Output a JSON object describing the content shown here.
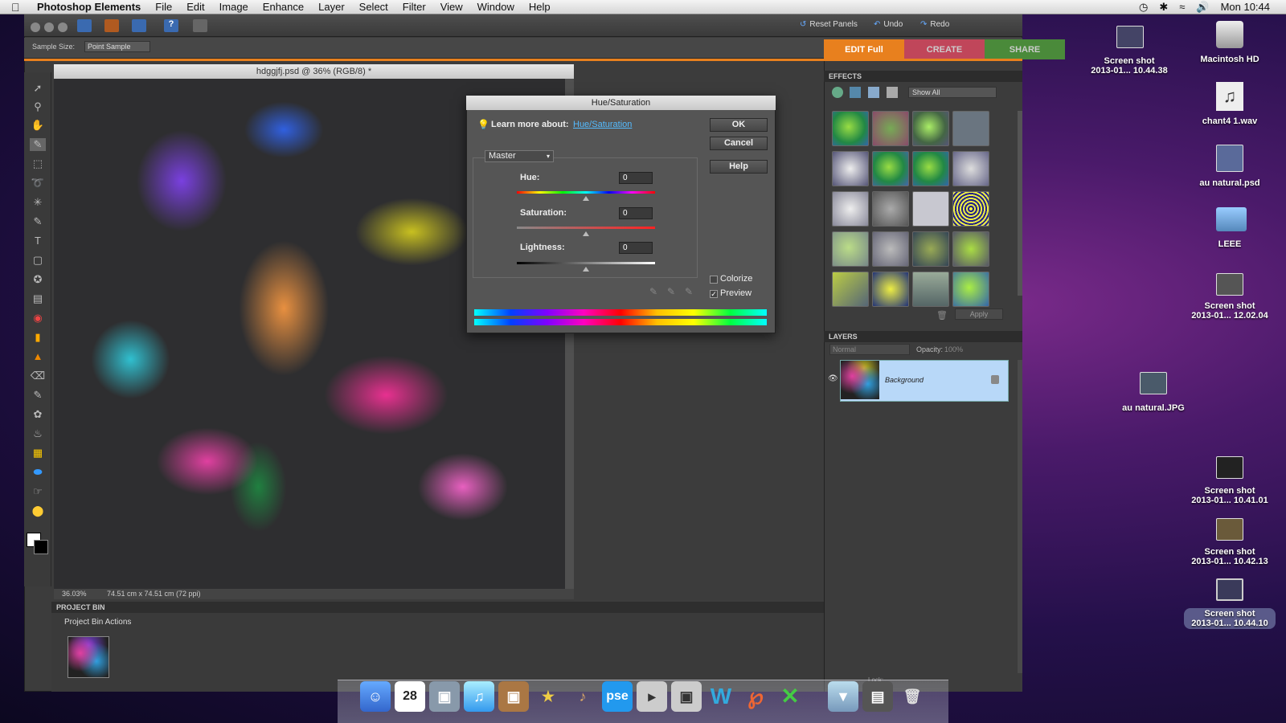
{
  "menubar": {
    "app": "Photoshop Elements",
    "items": [
      "File",
      "Edit",
      "Image",
      "Enhance",
      "Layer",
      "Select",
      "Filter",
      "View",
      "Window",
      "Help"
    ],
    "clock": "Mon 10:44"
  },
  "toolbar": {
    "reset": "Reset Panels",
    "undo": "Undo",
    "redo": "Redo"
  },
  "options": {
    "sample_label": "Sample Size:",
    "sample_value": "Point Sample"
  },
  "tabs": [
    {
      "label": "EDIT Full",
      "color": "#e8801e"
    },
    {
      "label": "CREATE",
      "color": "#c0465a"
    },
    {
      "label": "SHARE",
      "color": "#4a8a3a"
    }
  ],
  "doc": {
    "title": "hdggjfj.psd @ 36% (RGB/8) *",
    "zoom": "36.03%",
    "size": "74.51 cm x 74.51 cm (72 ppi)"
  },
  "project_bin": {
    "title": "PROJECT BIN",
    "actions": "Project Bin Actions"
  },
  "dialog": {
    "title": "Hue/Saturation",
    "learn": "Learn more about:",
    "learn_link": "Hue/Saturation",
    "ok": "OK",
    "cancel": "Cancel",
    "help": "Help",
    "channel": "Master",
    "hue_label": "Hue:",
    "hue_value": "0",
    "sat_label": "Saturation:",
    "sat_value": "0",
    "light_label": "Lightness:",
    "light_value": "0",
    "colorize": "Colorize",
    "colorize_checked": false,
    "preview": "Preview",
    "preview_checked": true
  },
  "effects": {
    "title": "EFFECTS",
    "filter": "Show All",
    "apply": "Apply"
  },
  "layers": {
    "title": "LAYERS",
    "mode": "Normal",
    "opacity_label": "Opacity:",
    "opacity_value": "100%",
    "layer_name": "Background",
    "lock": "Lock:"
  },
  "desktop": [
    {
      "l1": "Screen shot",
      "l2": "2013-01... 10.44.38"
    },
    {
      "l1": "Macintosh HD",
      "l2": ""
    },
    {
      "l1": "chant4 1.wav",
      "l2": ""
    },
    {
      "l1": "au natural.psd",
      "l2": ""
    },
    {
      "l1": "LEEE",
      "l2": ""
    },
    {
      "l1": "Screen shot",
      "l2": "2013-01... 12.02.04"
    },
    {
      "l1": "au natural.JPG",
      "l2": ""
    },
    {
      "l1": "Screen shot",
      "l2": "2013-01... 10.41.01"
    },
    {
      "l1": "Screen shot",
      "l2": "2013-01... 10.42.13"
    },
    {
      "l1": "Screen shot",
      "l2": "2013-01... 10.44.10"
    }
  ],
  "dock": {
    "calendar_day": "28",
    "pse": "pse",
    "word": "W"
  }
}
